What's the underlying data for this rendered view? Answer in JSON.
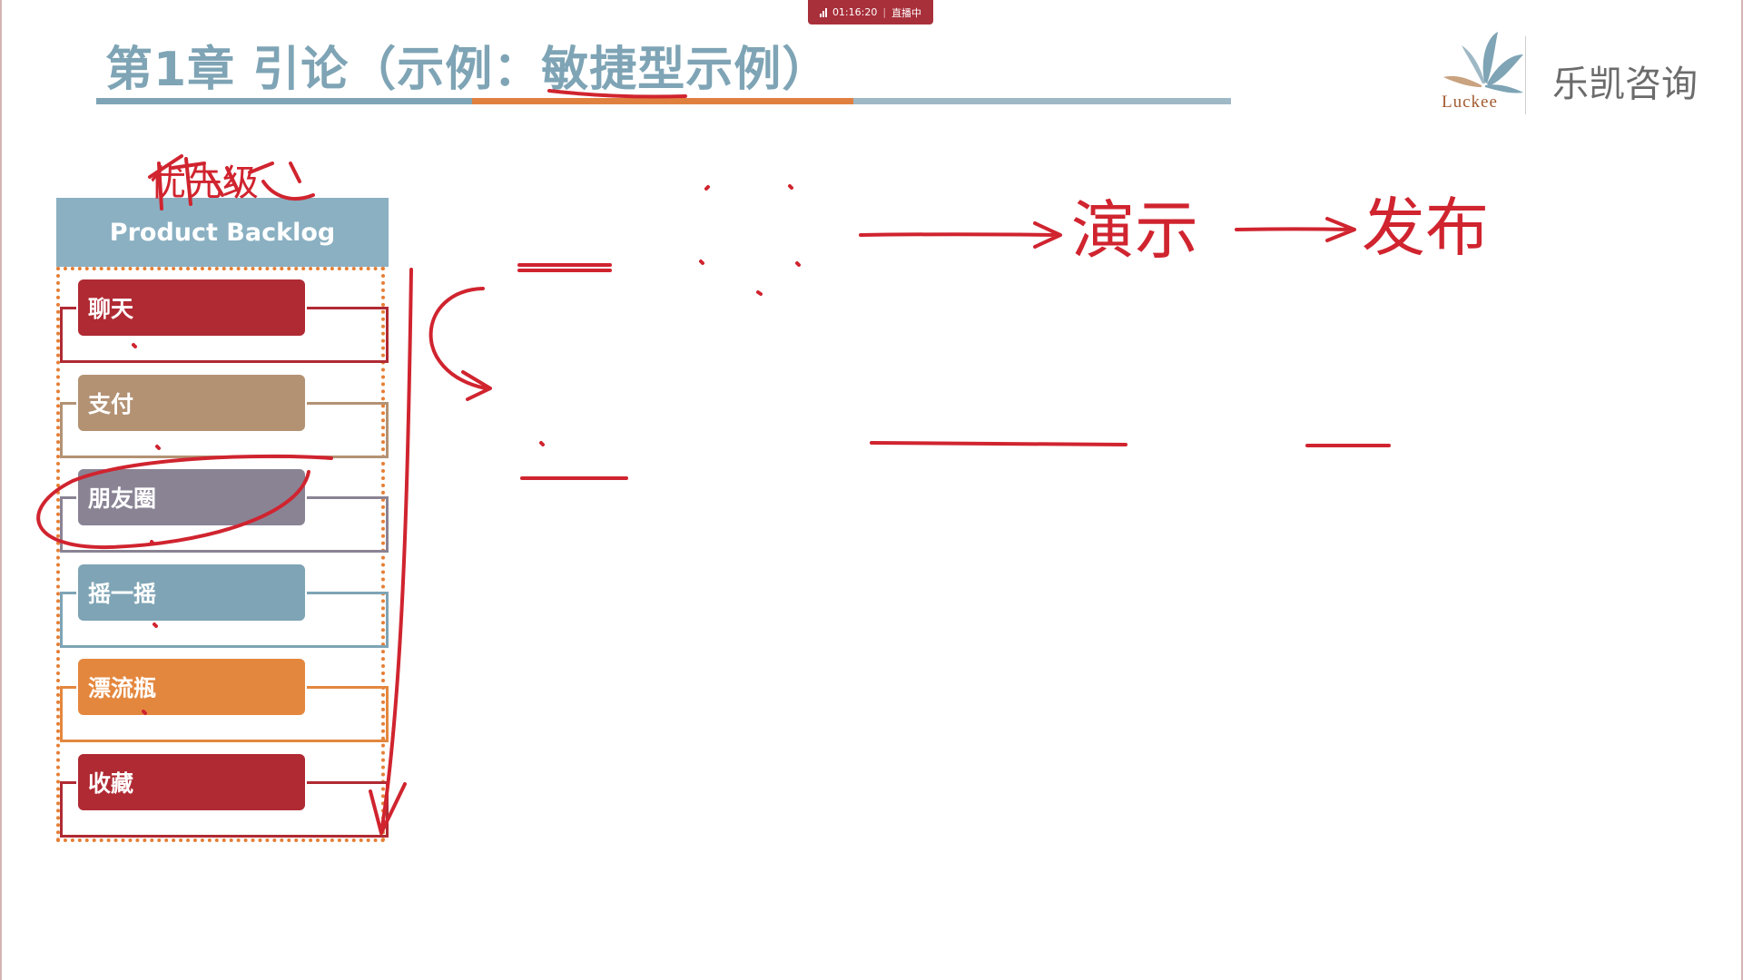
{
  "live_status": {
    "time": "01:16:20",
    "label": "直播中"
  },
  "slide": {
    "title": "第1章 引论（示例：敏捷型示例）"
  },
  "logo": {
    "name": "乐凯咨询",
    "subtitle": "Luckee"
  },
  "backlog": {
    "header": "Product Backlog",
    "items": [
      {
        "label": "聊天",
        "color": "#b02a33"
      },
      {
        "label": "支付",
        "color": "#b39274"
      },
      {
        "label": "朋友圈",
        "color": "#8a8394"
      },
      {
        "label": "摇一摇",
        "color": "#7ea4b5"
      },
      {
        "label": "漂流瓶",
        "color": "#e4873e"
      },
      {
        "label": "收藏",
        "color": "#b02a33"
      }
    ]
  },
  "annotations": {
    "demo": "演示",
    "release": "发布",
    "above_header": "优先级"
  },
  "colors": {
    "accent_blue": "#7ea4b5",
    "accent_orange": "#e0803f",
    "ink_red": "#d0242f"
  }
}
